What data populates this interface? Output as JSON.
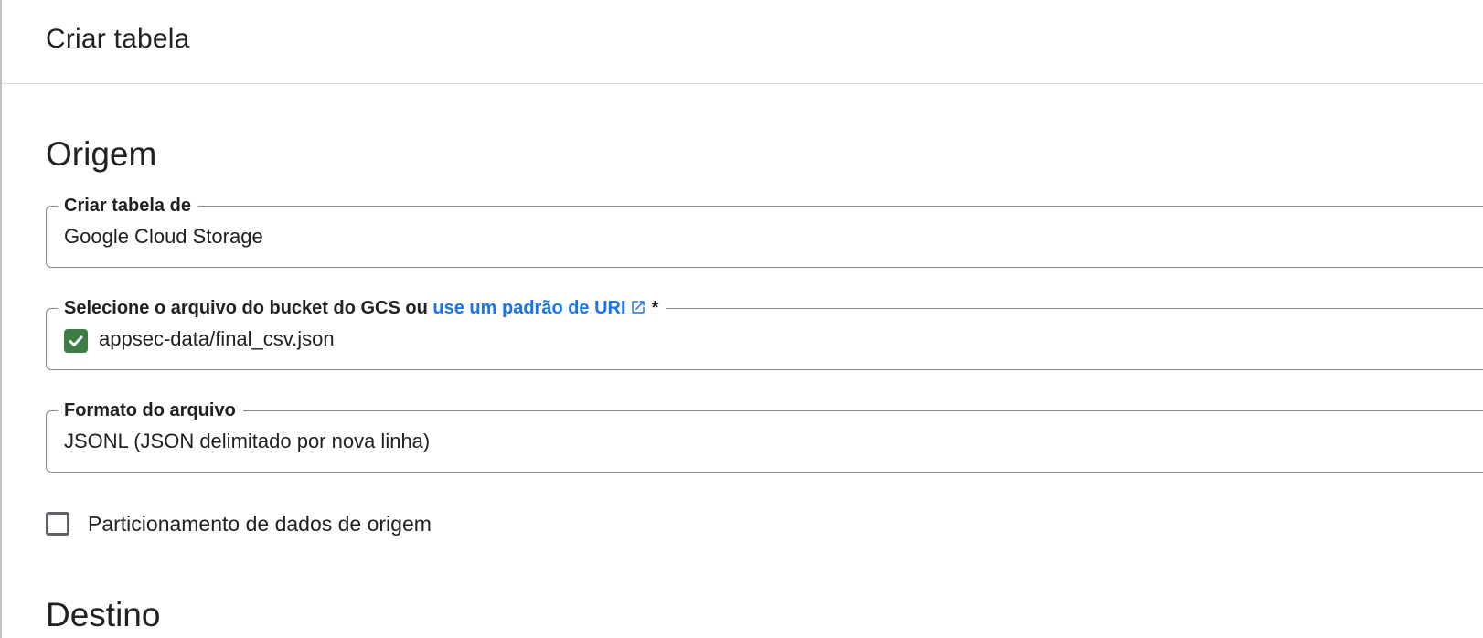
{
  "header": {
    "title": "Criar tabela"
  },
  "source": {
    "section_title": "Origem",
    "create_from": {
      "label": "Criar tabela de",
      "value": "Google Cloud Storage"
    },
    "gcs_file": {
      "label_prefix": "Selecione o arquivo do bucket do GCS ou",
      "link_text": "use um padrão de URI",
      "link_icon": "open-in-new-icon",
      "required_marker": "*",
      "value": "appsec-data/final_csv.json",
      "status_icon": "check-box-icon",
      "status_color": "#3a7d45"
    },
    "file_format": {
      "label": "Formato do arquivo",
      "value": "JSONL (JSON delimitado por nova linha)"
    },
    "partitioning": {
      "label": "Particionamento de dados de origem",
      "checked": false
    }
  },
  "destination": {
    "section_title": "Destino"
  },
  "colors": {
    "link": "#1a73e8",
    "border": "#80868b",
    "text": "#202124"
  }
}
